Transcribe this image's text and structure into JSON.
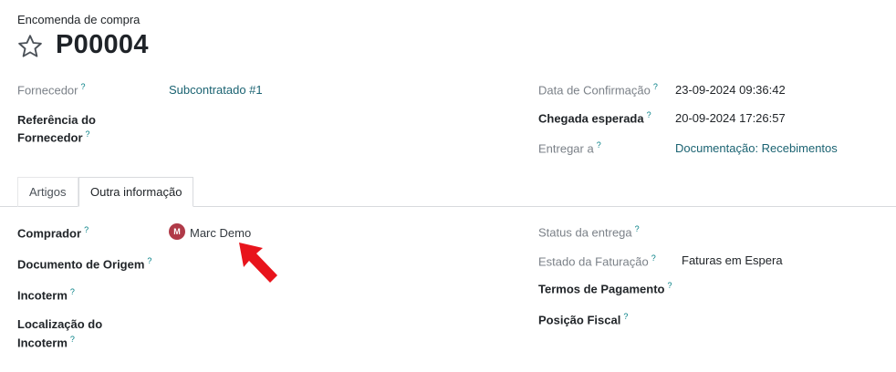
{
  "breadcrumb": "Encomenda de compra",
  "title": "P00004",
  "tooltip_mark": "?",
  "fields": {
    "fornecedor_label": "Fornecedor",
    "fornecedor_value": "Subcontratado #1",
    "referencia_label_line1": "Referência do",
    "referencia_label_line2": "Fornecedor",
    "data_confirmacao_label": "Data de Confirmação",
    "data_confirmacao_value": "23-09-2024 09:36:42",
    "chegada_label": "Chegada esperada",
    "chegada_value": "20-09-2024 17:26:57",
    "entregar_label": "Entregar a",
    "entregar_value": "Documentação: Recebimentos"
  },
  "tabs": [
    {
      "label": "Artigos",
      "active": false
    },
    {
      "label": "Outra informação",
      "active": true
    }
  ],
  "other_info": {
    "comprador_label": "Comprador",
    "comprador_value": "Marc Demo",
    "comprador_avatar_initial": "M",
    "documento_origem_label": "Documento de Origem",
    "incoterm_label": "Incoterm",
    "localizacao_label_line1": "Localização do",
    "localizacao_label_line2": "Incoterm",
    "status_entrega_label": "Status da entrega",
    "estado_faturacao_label": "Estado da Faturação",
    "estado_faturacao_value": "Faturas em Espera",
    "termos_pagamento_label": "Termos de Pagamento",
    "posicao_fiscal_label": "Posição Fiscal"
  },
  "icons": {
    "favorite": "star-outline-icon",
    "annotation": "red-arrow-icon"
  },
  "colors": {
    "link": "#1b6372",
    "tooltip": "#017e84",
    "avatar_bg": "#b03a48",
    "annotation_arrow": "#e8141c"
  }
}
